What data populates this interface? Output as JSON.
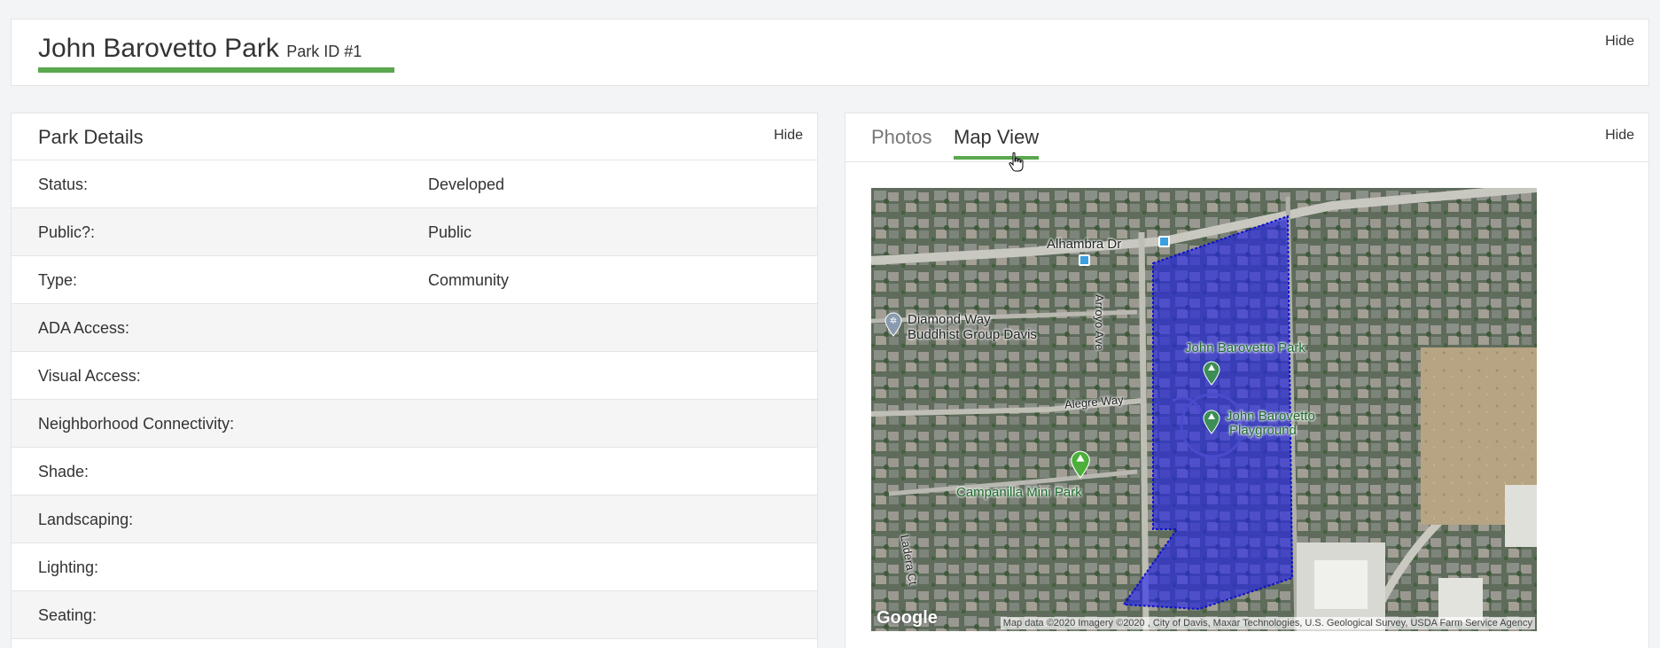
{
  "header": {
    "title": "John Barovetto Park",
    "park_id": "Park ID #1",
    "hide_label": "Hide"
  },
  "details": {
    "title": "Park Details",
    "hide_label": "Hide",
    "rows": [
      {
        "label": "Status:",
        "value": "Developed"
      },
      {
        "label": "Public?:",
        "value": "Public"
      },
      {
        "label": "Type:",
        "value": "Community"
      },
      {
        "label": "ADA Access:",
        "value": ""
      },
      {
        "label": "Visual Access:",
        "value": ""
      },
      {
        "label": "Neighborhood Connectivity:",
        "value": ""
      },
      {
        "label": "Shade:",
        "value": ""
      },
      {
        "label": "Landscaping:",
        "value": ""
      },
      {
        "label": "Lighting:",
        "value": ""
      },
      {
        "label": "Seating:",
        "value": ""
      }
    ]
  },
  "media": {
    "tabs": [
      {
        "label": "Photos",
        "active": false
      },
      {
        "label": "Map View",
        "active": true
      }
    ],
    "hide_label": "Hide",
    "map": {
      "labels": {
        "street_alhambra": "Alhambra Dr",
        "street_arroyo": "Arroyo Ave",
        "street_alegre": "Alegre Way",
        "street_ladera": "Ladera Ct",
        "poi_buddhist_1": "Diamond Way",
        "poi_buddhist_2": "Buddhist Group Davis",
        "poi_park": "John Barovetto Park",
        "poi_playground_1": "John Barovetto",
        "poi_playground_2": "Playground",
        "poi_campanilla": "Campanilla Mini Park"
      },
      "logo": "Google",
      "attribution": "Map data ©2020  Imagery ©2020 , City of Davis, Maxar Technologies, U.S. Geological Survey, USDA Farm Service Agency",
      "colors": {
        "park_polygon": "#2222ee",
        "accent": "#5aa84e"
      }
    }
  }
}
